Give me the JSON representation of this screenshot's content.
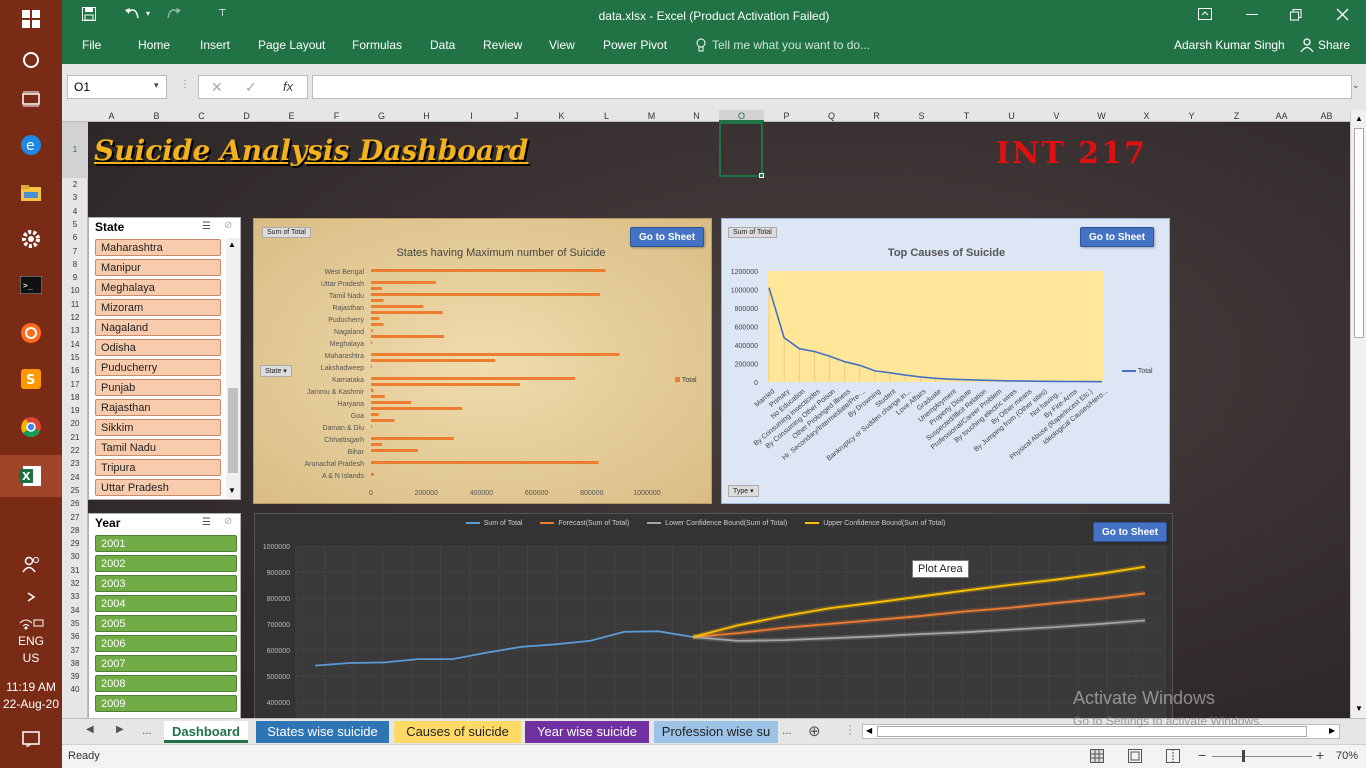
{
  "window": {
    "title": "data.xlsx - Excel (Product Activation Failed)",
    "user": "Adarsh Kumar Singh",
    "share_label": "Share"
  },
  "ribbon": {
    "tabs": [
      "File",
      "Home",
      "Insert",
      "Page Layout",
      "Formulas",
      "Data",
      "Review",
      "View",
      "Power Pivot"
    ],
    "tell_me_placeholder": "Tell me what you want to do..."
  },
  "formula_bar": {
    "name_box": "O1",
    "fx_label": "fx",
    "value": ""
  },
  "columns": [
    "A",
    "B",
    "C",
    "D",
    "E",
    "F",
    "G",
    "H",
    "I",
    "J",
    "K",
    "L",
    "M",
    "N",
    "O",
    "P",
    "Q",
    "R",
    "S",
    "T",
    "U",
    "V",
    "W",
    "X",
    "Y",
    "Z",
    "AA",
    "AB"
  ],
  "rows": [
    "1",
    "2",
    "3",
    "4",
    "5",
    "6",
    "7",
    "8",
    "9",
    "10",
    "11",
    "12",
    "13",
    "14",
    "15",
    "16",
    "17",
    "18",
    "19",
    "20",
    "21",
    "22",
    "23",
    "24",
    "25",
    "26",
    "27",
    "28",
    "29",
    "30",
    "31",
    "32",
    "33",
    "34",
    "35",
    "36",
    "37",
    "38",
    "39",
    "40"
  ],
  "dashboard": {
    "title": "Suicide Analysis Dashboard",
    "course_code": "INT 217",
    "goto_label": "Go to Sheet"
  },
  "state_slicer": {
    "header": "State",
    "items": [
      "Maharashtra",
      "Manipur",
      "Meghalaya",
      "Mizoram",
      "Nagaland",
      "Odisha",
      "Puducherry",
      "Punjab",
      "Rajasthan",
      "Sikkim",
      "Tamil Nadu",
      "Tripura",
      "Uttar Pradesh"
    ]
  },
  "year_slicer": {
    "header": "Year",
    "items": [
      "2001",
      "2002",
      "2003",
      "2004",
      "2005",
      "2006",
      "2007",
      "2008",
      "2009"
    ]
  },
  "chart_data": [
    {
      "type": "bar",
      "title": "States having Maximum number of Suicide",
      "field_button": "Sum of Total",
      "axis_button": "State",
      "legend": "Total",
      "categories": [
        "West Bengal",
        "Uttar Pradesh",
        "Tamil Nadu",
        "Rajasthan",
        "Puducherry",
        "Nagaland",
        "Meghalaya",
        "Maharashtra",
        "Lakshadweep",
        "Karnataka",
        "Jammu & Kashmir",
        "Haryana",
        "Goa",
        "Daman & Diu",
        "Chhattisgarh",
        "Bihar",
        "Arunachal Pradesh",
        "A & N Islands"
      ],
      "values": [
        850000,
        235000,
        830000,
        190000,
        30000,
        6000,
        4000,
        900000,
        500,
        740000,
        9000,
        145000,
        28000,
        1000,
        300000,
        170000,
        825000,
        10000
      ],
      "extra_bars": [
        0,
        40000,
        45000,
        260000,
        45000,
        265000,
        0,
        450000,
        0,
        540000,
        50000,
        330000,
        85000,
        0,
        40000,
        0,
        0,
        0
      ],
      "xlim": [
        0,
        1000000
      ],
      "xticks": [
        "0",
        "200000",
        "400000",
        "600000",
        "800000",
        "1000000"
      ]
    },
    {
      "type": "line",
      "title": "Top Causes of Suicide",
      "field_button": "Sum of Total",
      "axis_button": "Type",
      "legend": "Total",
      "ylim": [
        0,
        1200000
      ],
      "yticks": [
        "1200000",
        "1000000",
        "800000",
        "600000",
        "400000",
        "200000",
        "0"
      ],
      "categories": [
        "Married",
        "Primary",
        "No Education",
        "By Consuming Insecticides",
        "By Consuming Other Poison",
        "Other Prolonged Illness",
        "Hr. Secondary/Intermediate/Pre-...",
        "By Drowning",
        "Student",
        "Bankruptcy or Sudden change in...",
        "Love Affairs",
        "Graduate",
        "Unemployment",
        "Property Dispute",
        "Suspected/Illicit Relation",
        "Professional/Career Problem",
        "By touching electric wires",
        "By Other means",
        "By Jumping from (Other sites)",
        "Not having...",
        "By Fire-Arms",
        "Physical Abuse (Rape/Incest Etc.)",
        "Ideological Causes/Hero..."
      ],
      "values": [
        1020000,
        480000,
        360000,
        330000,
        280000,
        220000,
        180000,
        120000,
        100000,
        75000,
        55000,
        40000,
        30000,
        25000,
        20000,
        15000,
        12000,
        10000,
        8000,
        6000,
        5000,
        4000,
        3000
      ]
    },
    {
      "type": "line",
      "title": "",
      "series": [
        {
          "name": "Sum of Total",
          "color": "#5b9bd5",
          "values": [
            540000,
            550000,
            552000,
            565000,
            565000,
            590000,
            612000,
            622000,
            635000,
            670000,
            672000,
            650000
          ]
        },
        {
          "name": "Forecast(Sum of Total)",
          "color": "#ed7d31",
          "values": [
            650000,
            665000,
            685000,
            700000,
            715000,
            730000,
            748000,
            762000,
            780000,
            797000,
            818000
          ]
        },
        {
          "name": "Lower Confidence Bound(Sum of Total)",
          "color": "#a5a5a5",
          "values": [
            650000,
            635000,
            638000,
            645000,
            652000,
            661000,
            668000,
            678000,
            688000,
            700000,
            714000
          ]
        },
        {
          "name": "Upper Confidence Bound(Sum of Total)",
          "color": "#ffc000",
          "values": [
            650000,
            695000,
            730000,
            760000,
            782000,
            805000,
            828000,
            850000,
            870000,
            893000,
            920000
          ]
        }
      ],
      "ylim": [
        400000,
        1000000
      ],
      "yticks": [
        "1000000",
        "900000",
        "800000",
        "700000",
        "600000",
        "500000",
        "400000"
      ],
      "tooltip": "Plot Area"
    }
  ],
  "sheet_tabs": [
    "Dashboard",
    "States wise suicide",
    "Causes of suicide",
    "Year wise suicide",
    "Profession wise su"
  ],
  "sheet_tab_colors": [
    "#ffffff",
    "#2e75b6",
    "#ffd966",
    "#7030a0",
    "#9dc3e6"
  ],
  "status": {
    "ready": "Ready",
    "zoom": "70%"
  },
  "watermark": {
    "line1": "Activate Windows",
    "line2": "Go to Settings to activate Windows."
  },
  "taskbar": {
    "lang": "ENG",
    "region": "US",
    "time": "11:19 AM",
    "date": "22-Aug-20"
  }
}
